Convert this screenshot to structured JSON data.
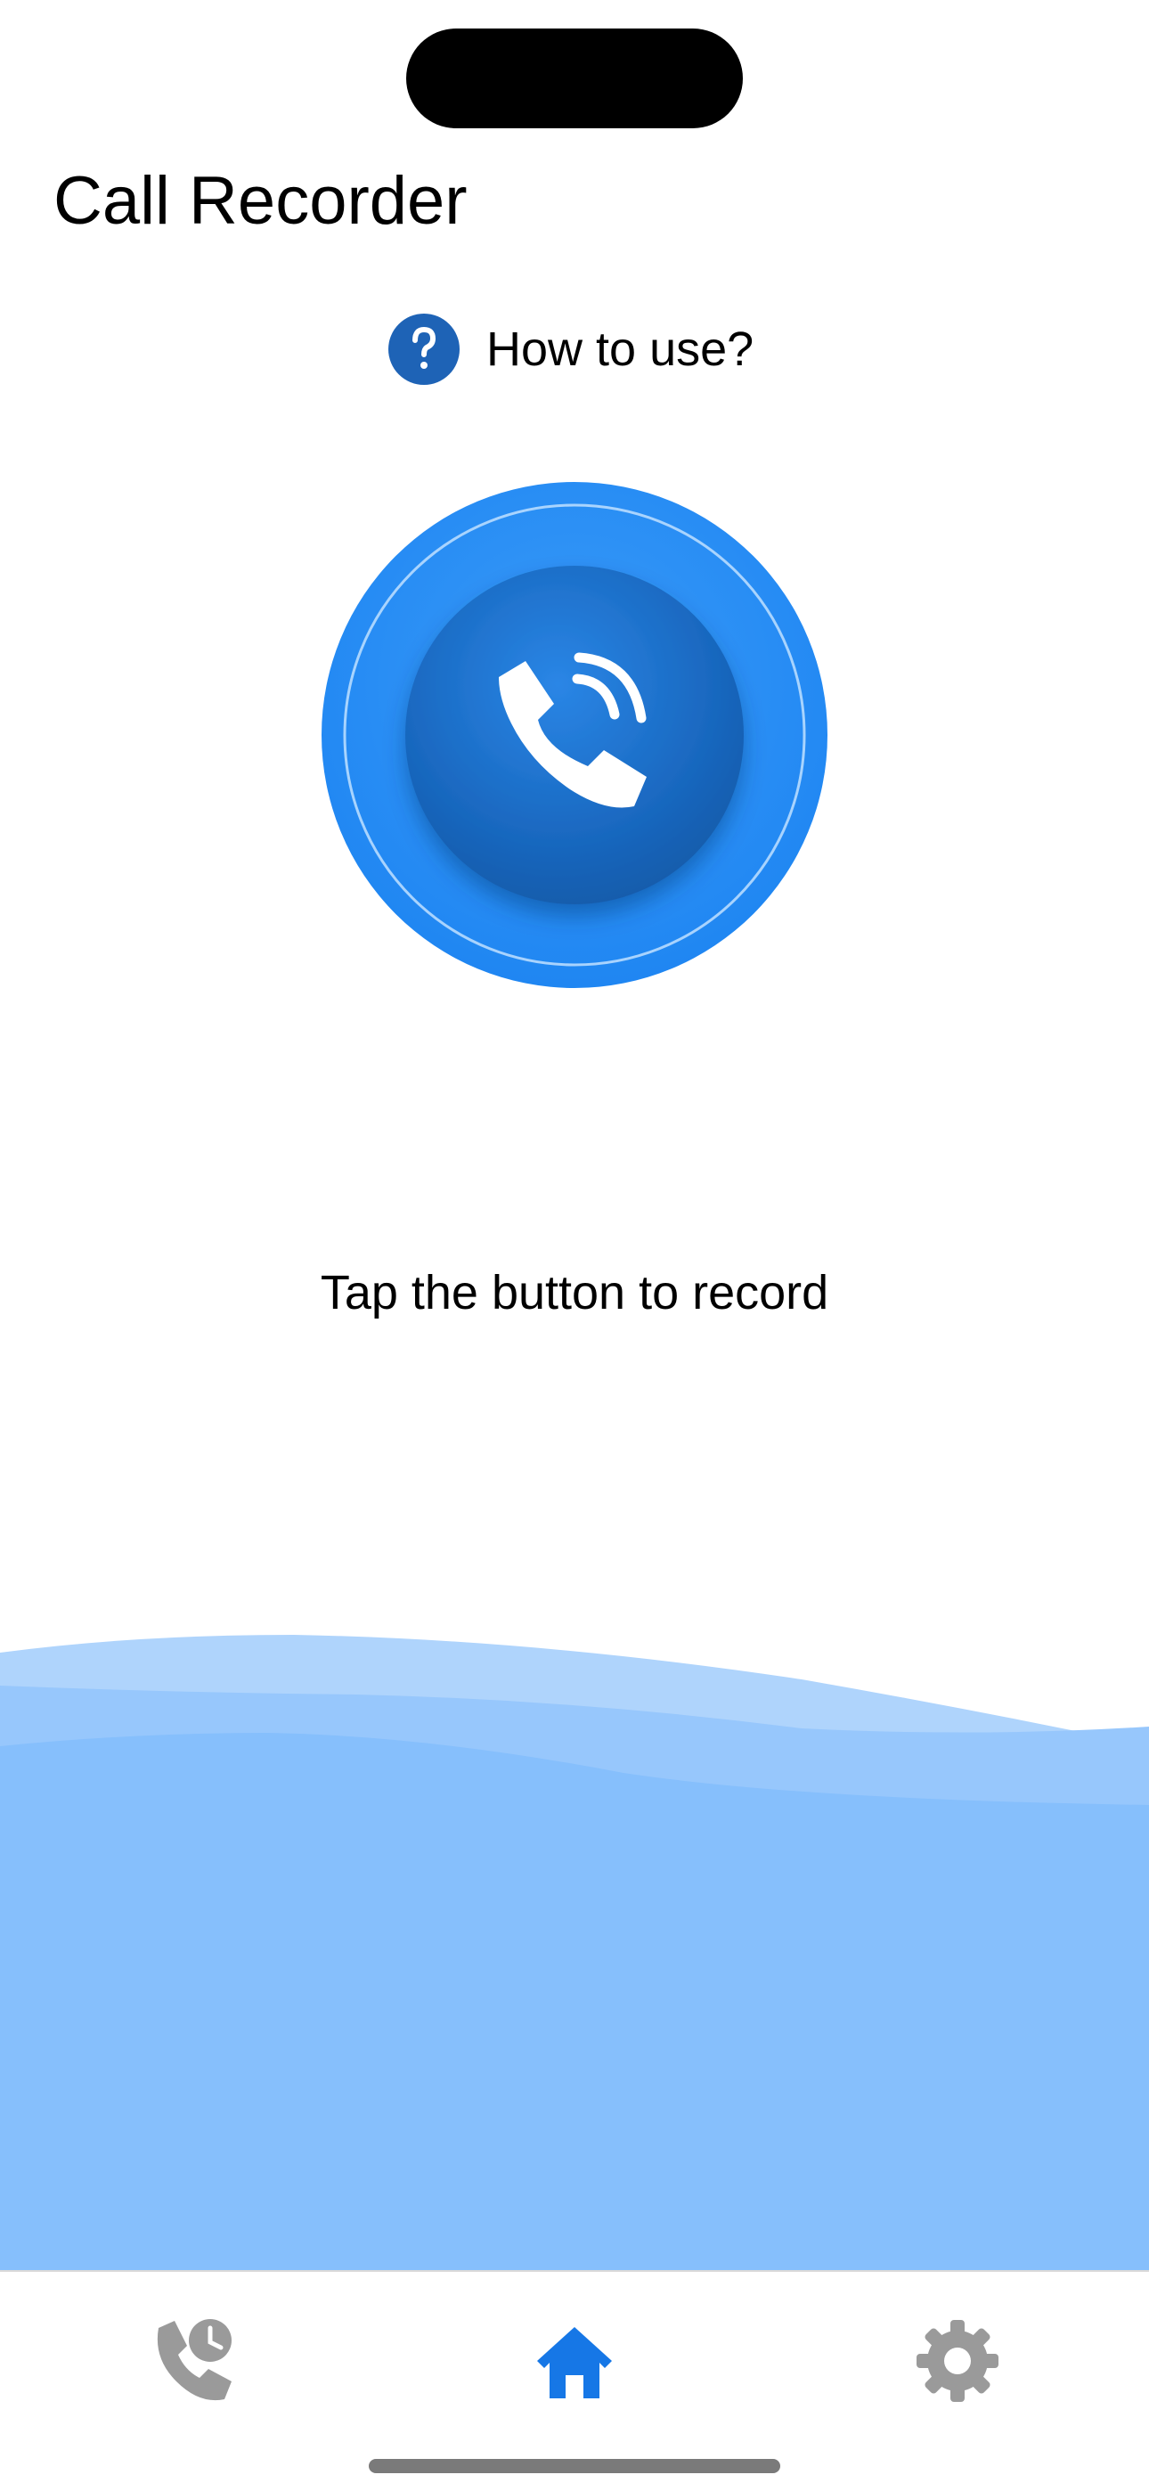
{
  "header": {
    "title": "Call Recorder"
  },
  "help": {
    "label": "How to use?",
    "icon": "question-mark-circle-icon",
    "color": "#1E63B6"
  },
  "record_button": {
    "icon": "phone-ringing-icon",
    "outer_color": "#2B8FF5",
    "inner_color": "#1764BA"
  },
  "hint": {
    "text": "Tap the button to record"
  },
  "waves": {
    "colors": [
      "#AFD4FC",
      "#97C7FC",
      "#86BFFC"
    ]
  },
  "tabbar": {
    "items": [
      {
        "name": "recent-calls",
        "icon": "phone-clock-icon",
        "active": false,
        "color": "#9A9A9A"
      },
      {
        "name": "home",
        "icon": "house-icon",
        "active": true,
        "color": "#1677E6"
      },
      {
        "name": "settings",
        "icon": "gear-icon",
        "active": false,
        "color": "#9A9A9A"
      }
    ]
  }
}
